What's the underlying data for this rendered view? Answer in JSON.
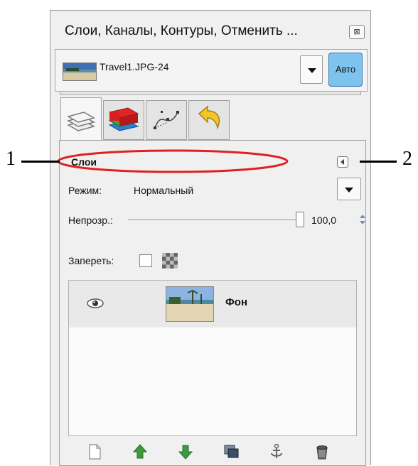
{
  "dock": {
    "title": "Слои, Каналы, Контуры, Отменить ...",
    "close_icon": "close-icon"
  },
  "image_selector": {
    "image_name": "Travel1.JPG-24",
    "auto_label": "Авто"
  },
  "tabs": [
    {
      "name": "layers-tab",
      "icon": "layers-icon",
      "active": true
    },
    {
      "name": "channels-tab",
      "icon": "channels-icon",
      "active": false
    },
    {
      "name": "paths-tab",
      "icon": "paths-icon",
      "active": false
    },
    {
      "name": "undo-tab",
      "icon": "undo-history-icon",
      "active": false
    }
  ],
  "layers_panel": {
    "title": "Слои",
    "mode_label": "Режим:",
    "mode_value": "Нормальный",
    "opacity_label": "Непрозр.:",
    "opacity_value": "100,0",
    "opacity_fraction": 1.0,
    "lock_label": "Запереть:",
    "layers": [
      {
        "name": "Фон",
        "visible": true
      }
    ],
    "bottom_buttons": [
      "new-layer-icon",
      "raise-layer-icon",
      "lower-layer-icon",
      "duplicate-layer-icon",
      "anchor-layer-icon",
      "delete-layer-icon"
    ]
  },
  "annotations": {
    "label_1": "1",
    "label_2": "2"
  },
  "colors": {
    "highlight_ellipse": "#e02020",
    "auto_button": "#7dc3ee",
    "arrow_icons": "#3c9a3c"
  }
}
